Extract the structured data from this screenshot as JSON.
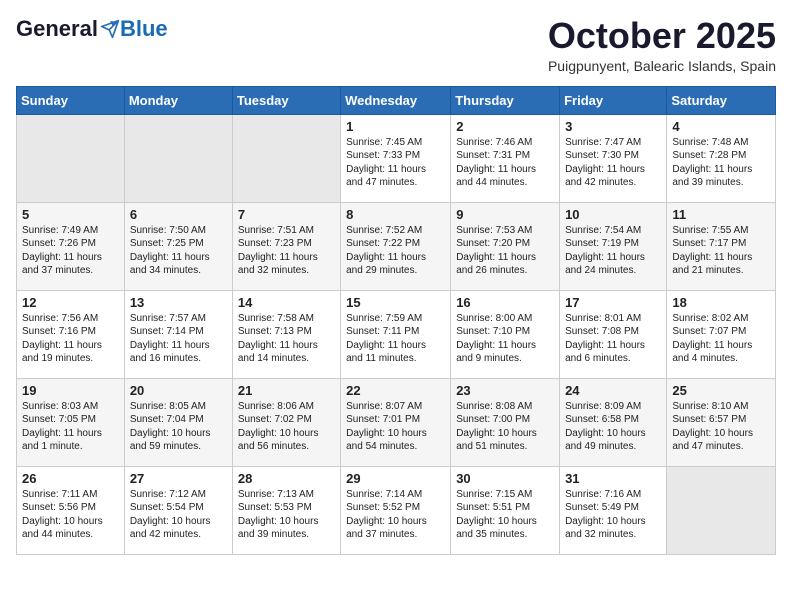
{
  "header": {
    "logo_general": "General",
    "logo_blue": "Blue",
    "month_title": "October 2025",
    "location": "Puigpunyent, Balearic Islands, Spain"
  },
  "weekdays": [
    "Sunday",
    "Monday",
    "Tuesday",
    "Wednesday",
    "Thursday",
    "Friday",
    "Saturday"
  ],
  "weeks": [
    [
      {
        "day": "",
        "sunrise": "",
        "sunset": "",
        "daylight": "",
        "empty": true
      },
      {
        "day": "",
        "sunrise": "",
        "sunset": "",
        "daylight": "",
        "empty": true
      },
      {
        "day": "",
        "sunrise": "",
        "sunset": "",
        "daylight": "",
        "empty": true
      },
      {
        "day": "1",
        "sunrise": "7:45 AM",
        "sunset": "7:33 PM",
        "daylight": "11 hours and 47 minutes."
      },
      {
        "day": "2",
        "sunrise": "7:46 AM",
        "sunset": "7:31 PM",
        "daylight": "11 hours and 44 minutes."
      },
      {
        "day": "3",
        "sunrise": "7:47 AM",
        "sunset": "7:30 PM",
        "daylight": "11 hours and 42 minutes."
      },
      {
        "day": "4",
        "sunrise": "7:48 AM",
        "sunset": "7:28 PM",
        "daylight": "11 hours and 39 minutes."
      }
    ],
    [
      {
        "day": "5",
        "sunrise": "7:49 AM",
        "sunset": "7:26 PM",
        "daylight": "11 hours and 37 minutes."
      },
      {
        "day": "6",
        "sunrise": "7:50 AM",
        "sunset": "7:25 PM",
        "daylight": "11 hours and 34 minutes."
      },
      {
        "day": "7",
        "sunrise": "7:51 AM",
        "sunset": "7:23 PM",
        "daylight": "11 hours and 32 minutes."
      },
      {
        "day": "8",
        "sunrise": "7:52 AM",
        "sunset": "7:22 PM",
        "daylight": "11 hours and 29 minutes."
      },
      {
        "day": "9",
        "sunrise": "7:53 AM",
        "sunset": "7:20 PM",
        "daylight": "11 hours and 26 minutes."
      },
      {
        "day": "10",
        "sunrise": "7:54 AM",
        "sunset": "7:19 PM",
        "daylight": "11 hours and 24 minutes."
      },
      {
        "day": "11",
        "sunrise": "7:55 AM",
        "sunset": "7:17 PM",
        "daylight": "11 hours and 21 minutes."
      }
    ],
    [
      {
        "day": "12",
        "sunrise": "7:56 AM",
        "sunset": "7:16 PM",
        "daylight": "11 hours and 19 minutes."
      },
      {
        "day": "13",
        "sunrise": "7:57 AM",
        "sunset": "7:14 PM",
        "daylight": "11 hours and 16 minutes."
      },
      {
        "day": "14",
        "sunrise": "7:58 AM",
        "sunset": "7:13 PM",
        "daylight": "11 hours and 14 minutes."
      },
      {
        "day": "15",
        "sunrise": "7:59 AM",
        "sunset": "7:11 PM",
        "daylight": "11 hours and 11 minutes."
      },
      {
        "day": "16",
        "sunrise": "8:00 AM",
        "sunset": "7:10 PM",
        "daylight": "11 hours and 9 minutes."
      },
      {
        "day": "17",
        "sunrise": "8:01 AM",
        "sunset": "7:08 PM",
        "daylight": "11 hours and 6 minutes."
      },
      {
        "day": "18",
        "sunrise": "8:02 AM",
        "sunset": "7:07 PM",
        "daylight": "11 hours and 4 minutes."
      }
    ],
    [
      {
        "day": "19",
        "sunrise": "8:03 AM",
        "sunset": "7:05 PM",
        "daylight": "11 hours and 1 minute."
      },
      {
        "day": "20",
        "sunrise": "8:05 AM",
        "sunset": "7:04 PM",
        "daylight": "10 hours and 59 minutes."
      },
      {
        "day": "21",
        "sunrise": "8:06 AM",
        "sunset": "7:02 PM",
        "daylight": "10 hours and 56 minutes."
      },
      {
        "day": "22",
        "sunrise": "8:07 AM",
        "sunset": "7:01 PM",
        "daylight": "10 hours and 54 minutes."
      },
      {
        "day": "23",
        "sunrise": "8:08 AM",
        "sunset": "7:00 PM",
        "daylight": "10 hours and 51 minutes."
      },
      {
        "day": "24",
        "sunrise": "8:09 AM",
        "sunset": "6:58 PM",
        "daylight": "10 hours and 49 minutes."
      },
      {
        "day": "25",
        "sunrise": "8:10 AM",
        "sunset": "6:57 PM",
        "daylight": "10 hours and 47 minutes."
      }
    ],
    [
      {
        "day": "26",
        "sunrise": "7:11 AM",
        "sunset": "5:56 PM",
        "daylight": "10 hours and 44 minutes."
      },
      {
        "day": "27",
        "sunrise": "7:12 AM",
        "sunset": "5:54 PM",
        "daylight": "10 hours and 42 minutes."
      },
      {
        "day": "28",
        "sunrise": "7:13 AM",
        "sunset": "5:53 PM",
        "daylight": "10 hours and 39 minutes."
      },
      {
        "day": "29",
        "sunrise": "7:14 AM",
        "sunset": "5:52 PM",
        "daylight": "10 hours and 37 minutes."
      },
      {
        "day": "30",
        "sunrise": "7:15 AM",
        "sunset": "5:51 PM",
        "daylight": "10 hours and 35 minutes."
      },
      {
        "day": "31",
        "sunrise": "7:16 AM",
        "sunset": "5:49 PM",
        "daylight": "10 hours and 32 minutes."
      },
      {
        "day": "",
        "sunrise": "",
        "sunset": "",
        "daylight": "",
        "empty": true
      }
    ]
  ]
}
